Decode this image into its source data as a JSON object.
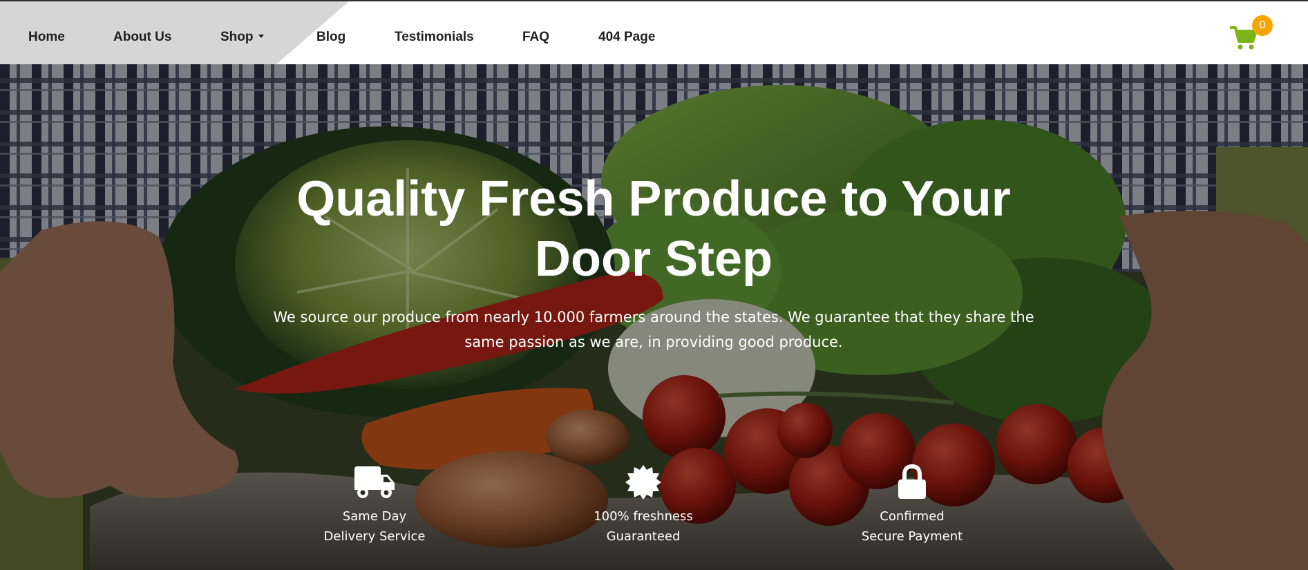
{
  "nav": {
    "items": [
      {
        "label": "Home"
      },
      {
        "label": "About Us"
      },
      {
        "label": "Shop"
      },
      {
        "label": "Blog"
      },
      {
        "label": "Testimonials"
      },
      {
        "label": "FAQ"
      },
      {
        "label": "404 Page"
      }
    ],
    "cart": {
      "icon": "cart-icon",
      "count": "0",
      "icon_color": "#7cb518",
      "badge_color": "#f6a500"
    }
  },
  "hero": {
    "title": "Quality Fresh Produce to Your Door Step",
    "subtitle": "We source our produce from nearly 10.000 farmers around the states. We guarantee that they share the same passion as we are, in providing good produce.",
    "features": [
      {
        "icon": "truck-icon",
        "line1": "Same Day",
        "line2": "Delivery Service"
      },
      {
        "icon": "certificate-icon",
        "line1": "100% freshness",
        "line2": "Guaranteed"
      },
      {
        "icon": "lock-icon",
        "line1": "Confirmed",
        "line2": "Secure Payment"
      }
    ]
  }
}
